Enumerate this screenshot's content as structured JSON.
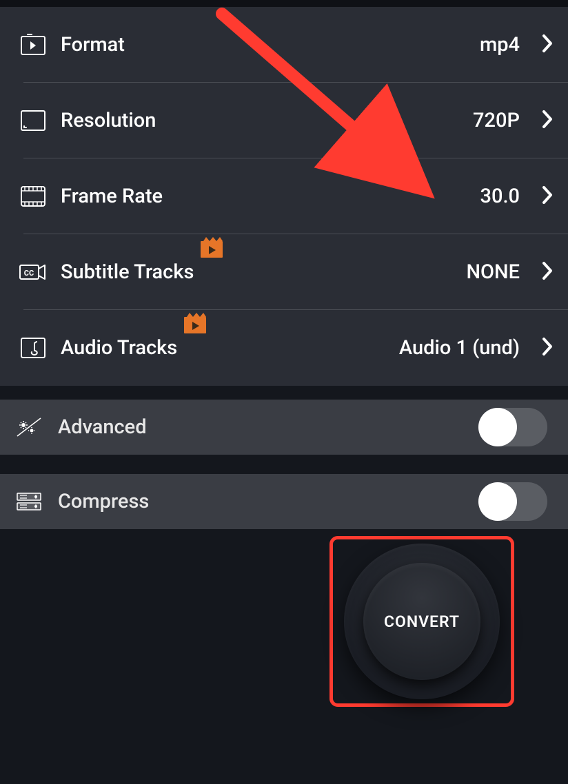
{
  "settings": [
    {
      "id": "format",
      "label": "Format",
      "value": "mp4",
      "badge": false
    },
    {
      "id": "resolution",
      "label": "Resolution",
      "value": "720P",
      "badge": false
    },
    {
      "id": "framerate",
      "label": "Frame Rate",
      "value": "30.0",
      "badge": false
    },
    {
      "id": "subtitles",
      "label": "Subtitle Tracks",
      "value": "NONE",
      "badge": true
    },
    {
      "id": "audio",
      "label": "Audio Tracks",
      "value": "Audio 1 (und)",
      "badge": true
    }
  ],
  "toggles": {
    "advanced": {
      "label": "Advanced",
      "on": false
    },
    "compress": {
      "label": "Compress",
      "on": false
    }
  },
  "convert": {
    "label": "CONVERT"
  },
  "annotation": {
    "highlight_target": "convert-button"
  }
}
